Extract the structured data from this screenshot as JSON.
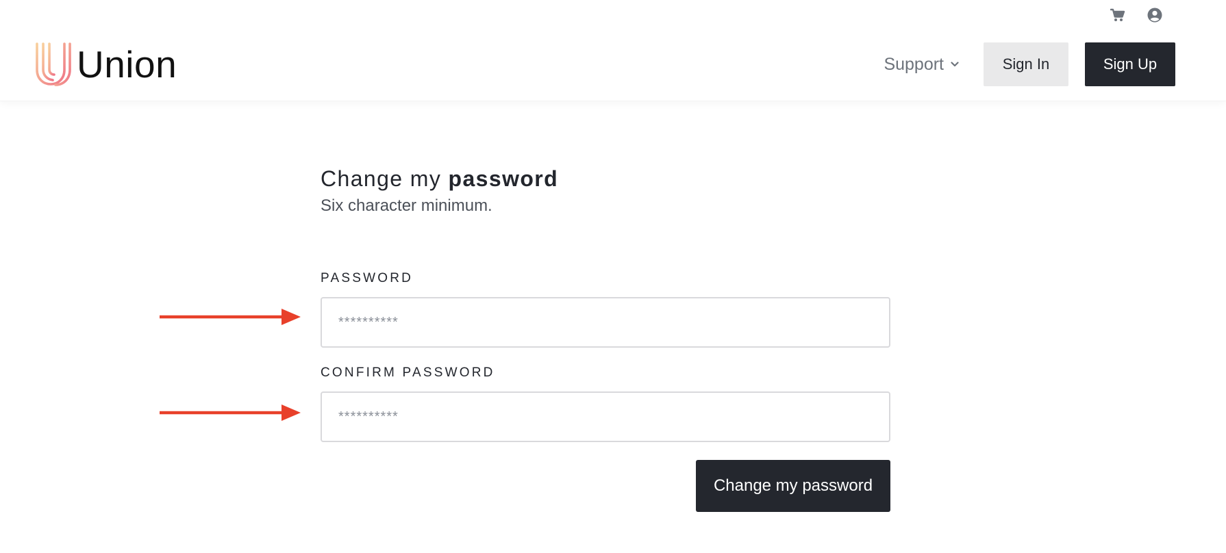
{
  "header": {
    "brand": "Union",
    "utility_icons": [
      "cart-icon",
      "user-circle-icon"
    ],
    "nav": {
      "support_label": "Support",
      "signin_label": "Sign In",
      "signup_label": "Sign Up"
    }
  },
  "form": {
    "title_prefix": "Change my ",
    "title_emphasis": "password",
    "subtitle": "Six character minimum.",
    "password": {
      "label": "PASSWORD",
      "placeholder": "**********",
      "value": ""
    },
    "confirm_password": {
      "label": "CONFIRM PASSWORD",
      "placeholder": "**********",
      "value": ""
    },
    "submit_label": "Change my password"
  },
  "colors": {
    "primary_dark": "#24272e",
    "secondary_button": "#e9e9ea",
    "annotation_arrow": "#e8402a",
    "logo_gradient": [
      "#f7c9a0",
      "#f07e8a"
    ]
  }
}
